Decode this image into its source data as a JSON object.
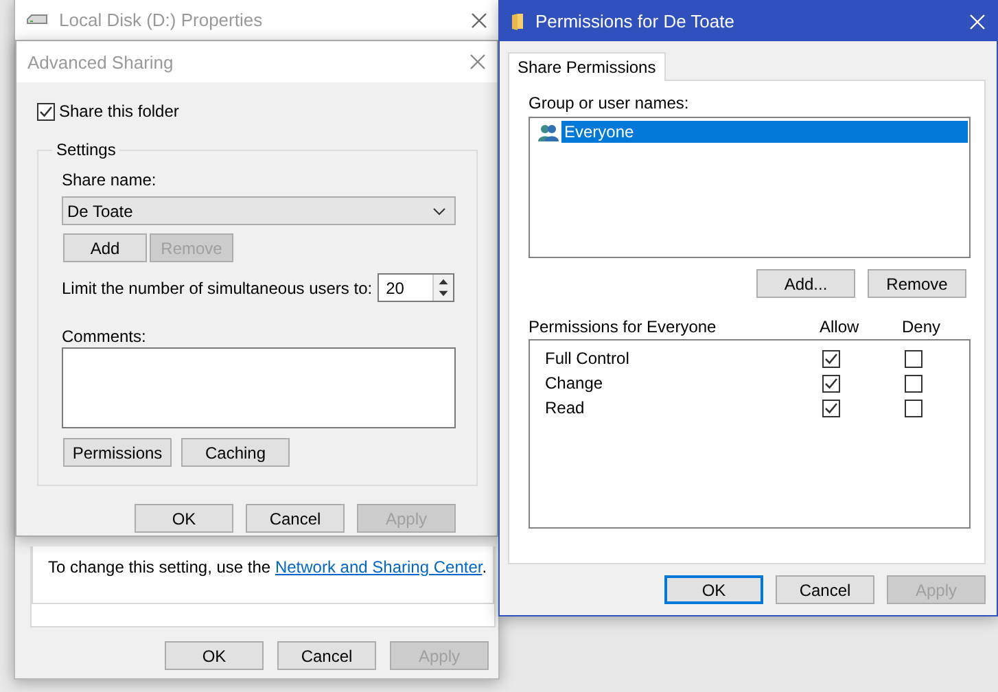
{
  "properties_window": {
    "title": "Local Disk (D:) Properties",
    "info_text": "To change this setting, use the",
    "info_link": "Network and Sharing Center",
    "info_end": ".",
    "buttons": [
      {
        "label": "OK",
        "disabled": false
      },
      {
        "label": "Cancel",
        "disabled": false
      },
      {
        "label": "Apply",
        "disabled": true
      }
    ]
  },
  "advanced_sharing": {
    "title": "Advanced Sharing",
    "share_checkbox": {
      "label": "Share this folder",
      "checked": true
    },
    "settings_legend": "Settings",
    "share_name_label": "Share name:",
    "share_name_value": "De Toate",
    "share_buttons": [
      {
        "label": "Add",
        "disabled": false
      },
      {
        "label": "Remove",
        "disabled": true
      }
    ],
    "limit_label": "Limit the number of simultaneous users to:",
    "limit_value": "20",
    "comments_label": "Comments:",
    "extra_buttons": [
      {
        "label": "Permissions",
        "disabled": false
      },
      {
        "label": "Caching",
        "disabled": false
      }
    ],
    "buttons": [
      {
        "label": "OK",
        "disabled": false
      },
      {
        "label": "Cancel",
        "disabled": false
      },
      {
        "label": "Apply",
        "disabled": true
      }
    ]
  },
  "permissions_window": {
    "title": "Permissions for De Toate",
    "tabs": [
      {
        "label": "Share Permissions",
        "selected": true
      }
    ],
    "group_label": "Group or user names:",
    "users": [
      {
        "name": "Everyone",
        "selected": true
      }
    ],
    "user_buttons": [
      {
        "label": "Add...",
        "disabled": false
      },
      {
        "label": "Remove",
        "disabled": false
      }
    ],
    "permissions_label": "Permissions for Everyone",
    "columns": [
      "Allow",
      "Deny"
    ],
    "permissions": [
      {
        "name": "Full Control",
        "allow": true,
        "deny": false
      },
      {
        "name": "Change",
        "allow": true,
        "deny": false
      },
      {
        "name": "Read",
        "allow": true,
        "deny": false
      }
    ],
    "buttons": [
      {
        "label": "OK",
        "disabled": false,
        "default": true
      },
      {
        "label": "Cancel",
        "disabled": false,
        "default": false
      },
      {
        "label": "Apply",
        "disabled": true,
        "default": false
      }
    ]
  }
}
